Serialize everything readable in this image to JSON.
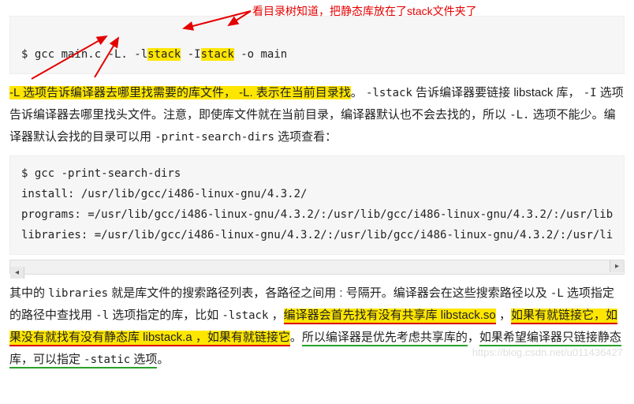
{
  "annot_top": "看目录树知道，把静态库放在了stack文件夹了",
  "code1": {
    "prefix": "$ gcc main.c -L. -l",
    "hl1": "stack",
    "mid": " -I",
    "hl2": "stack",
    "suffix": " -o main"
  },
  "para1": {
    "hl_lead": "-L 选项告诉编译器去哪里找需要的库文件， -L. 表示在当前目录找",
    "after_lead": "。 ",
    "mono1": "-lstack",
    "txt1": " 告诉编译器要链接 libstack 库， ",
    "mono2": "-I",
    "txt2": " 选项告诉编译器去哪里找头文件。注意，即使库文件就在当前目录，编译器默认也不会去找的，所以 ",
    "mono3": "-L.",
    "txt3": " 选项不能少。编译器默认会找的目录可以用 ",
    "mono4": "-print-search-dirs",
    "txt4": " 选项查看："
  },
  "code2": "$ gcc -print-search-dirs\ninstall: /usr/lib/gcc/i486-linux-gnu/4.3.2/\nprograms: =/usr/lib/gcc/i486-linux-gnu/4.3.2/:/usr/lib/gcc/i486-linux-gnu/4.3.2/:/usr/lib\nlibraries: =/usr/lib/gcc/i486-linux-gnu/4.3.2/:/usr/lib/gcc/i486-linux-gnu/4.3.2/:/usr/li",
  "para2": {
    "t1": "其中的 ",
    "m1": "libraries",
    "t2": " 就是库文件的搜索路径列表，各路径之间用 : 号隔开。编译器会在这些搜索路径以及 ",
    "m2": "-L",
    "t3": " 选项指定的路径中查找用 ",
    "m3": "-l",
    "t4": " 选项指定的库，比如 ",
    "m4": "-lstack",
    "t5": " ，",
    "hlA": "编译器会首先找有没有共享库 libstack.so",
    "t6": " ，",
    "hlB": "如果有就链接它，如果没有就找有没有静态库 libstack.a ，如果有就链接它",
    "t7": "。",
    "greenA": "所以编译器是优先考虑共享库的",
    "t8": "，",
    "greenB": "如果希望编译器只链接静态库，可以指定 ",
    "m5": "-static",
    "greenC": " 选项",
    "t9": "。"
  },
  "watermark": "https://blog.csdn.net/u011436427"
}
